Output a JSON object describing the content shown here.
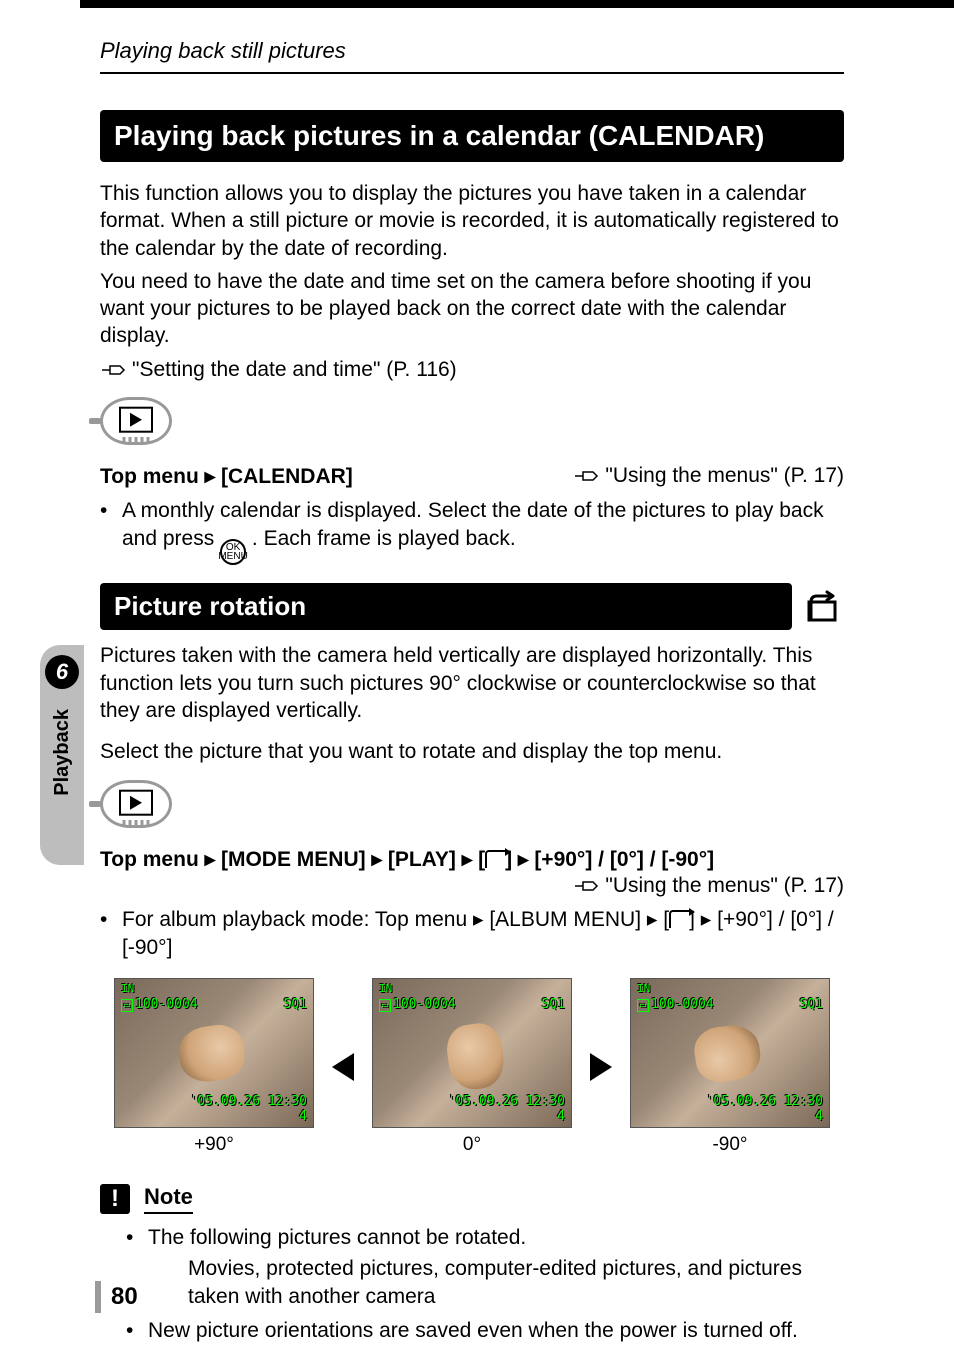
{
  "breadcrumb": "Playing back still pictures",
  "side_tab": {
    "number": "6",
    "label": "Playback"
  },
  "section1": {
    "title": "Playing back pictures in a calendar (CALENDAR)",
    "para1": "This function allows you to display the pictures you have taken in a calendar format. When a still picture or movie is recorded, it is automatically registered to the calendar by the date of recording.",
    "para2": "You need to have the date and time set on the camera before shooting if you want your pictures to be played back on the correct date with the calendar display.",
    "ref1": "\"Setting the date and time\" (P. 116)",
    "menupath_left": "Top menu ▸ [CALENDAR]",
    "menupath_right": "\"Using the menus\" (P. 17)",
    "bullet": "A monthly calendar is displayed. Select the date of the pictures to play back and press ",
    "bullet_tail": ". Each frame is played back.",
    "ok_label": "OK\nMENU"
  },
  "section2": {
    "title": "Picture rotation",
    "para1": "Pictures taken with the camera held vertically are displayed horizontally. This function lets you turn such pictures 90° clockwise or counterclockwise so that they are displayed vertically.",
    "para2": "Select the picture that you want to rotate and display the top menu.",
    "menupath_left": "Top menu ▸ [MODE MENU] ▸ [PLAY] ▸ [",
    "menupath_left2": "] ▸ [+90°] / [0°] / [-90°]",
    "menupath_right": "\"Using the menus\" (P. 17)",
    "bullet_pre": "For album playback mode: Top menu ▸ [ALBUM MENU] ▸ [",
    "bullet_post": "] ▸ [+90°] / [0°] / [-90°]",
    "thumbs": {
      "ov_in": "IN",
      "ov_file": "100-0004",
      "ov_sq": "SQ1",
      "ov_date": "'05.09.26 12:30",
      "ov_num": "4",
      "captions": [
        "+90°",
        "0°",
        "-90°"
      ]
    }
  },
  "note": {
    "badge": "!",
    "label": "Note",
    "b1": "The following pictures cannot be rotated.",
    "b1sub": "Movies, protected pictures, computer-edited pictures, and pictures taken with another camera",
    "b2": "New picture orientations are saved even when the power is turned off."
  },
  "page_number": "80"
}
